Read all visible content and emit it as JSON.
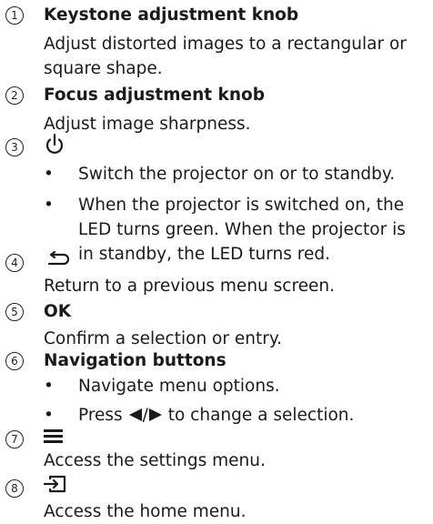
{
  "items": [
    {
      "number": "1",
      "title": "Keystone adjustment knob",
      "lines": [
        "Adjust distorted images to a rectangular or",
        "square shape."
      ]
    },
    {
      "number": "2",
      "title": "Focus adjustment knob",
      "lines": [
        "Adjust image sharpness."
      ]
    },
    {
      "number": "3",
      "icon": "power-icon",
      "bullets": [
        {
          "lines": [
            "Switch the projector on or to standby."
          ]
        },
        {
          "lines": [
            "When the projector is switched on, the",
            "LED turns green. When the projector is",
            "in standby, the LED turns red."
          ]
        }
      ]
    },
    {
      "number": "4",
      "icon": "back-arrow-icon",
      "lines": [
        "Return to a previous menu screen."
      ]
    },
    {
      "number": "5",
      "title": "OK",
      "lines": [
        "Confirm a selection or entry."
      ]
    },
    {
      "number": "6",
      "title": "Navigation buttons",
      "bullets": [
        {
          "lines": [
            "Navigate menu options."
          ]
        },
        {
          "before": "Press",
          "after": "to change a selection."
        }
      ]
    },
    {
      "number": "7",
      "icon": "menu-icon",
      "lines": [
        "Access the settings menu."
      ]
    },
    {
      "number": "8",
      "icon": "input-source-icon",
      "lines": [
        "Access the home menu."
      ]
    }
  ],
  "bullet_char": "•",
  "arrow_separator": "/"
}
